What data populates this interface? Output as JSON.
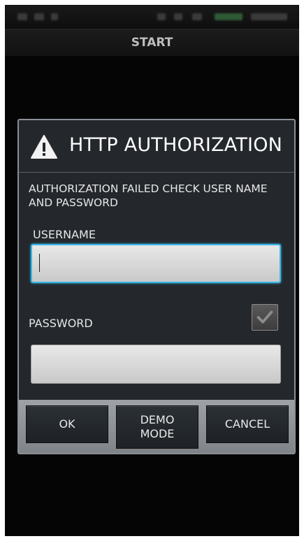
{
  "screen": {
    "title": "START"
  },
  "dialog": {
    "title": "HTTP AUTHORIZATION",
    "icon": "warning-icon",
    "message": "AUTHORIZATION FAILED CHECK USER NAME AND PASSWORD",
    "username_label": "USERNAME",
    "username_value": "",
    "password_label": "PASSWORD",
    "password_value": "",
    "show_password_checked": true,
    "buttons": {
      "ok": "OK",
      "demo_line1": "DEMO",
      "demo_line2": "MODE",
      "cancel": "CANCEL"
    }
  },
  "colors": {
    "dialog_bg": "#24282c",
    "focus": "#39b7e6",
    "button_bg": "#23272b"
  }
}
